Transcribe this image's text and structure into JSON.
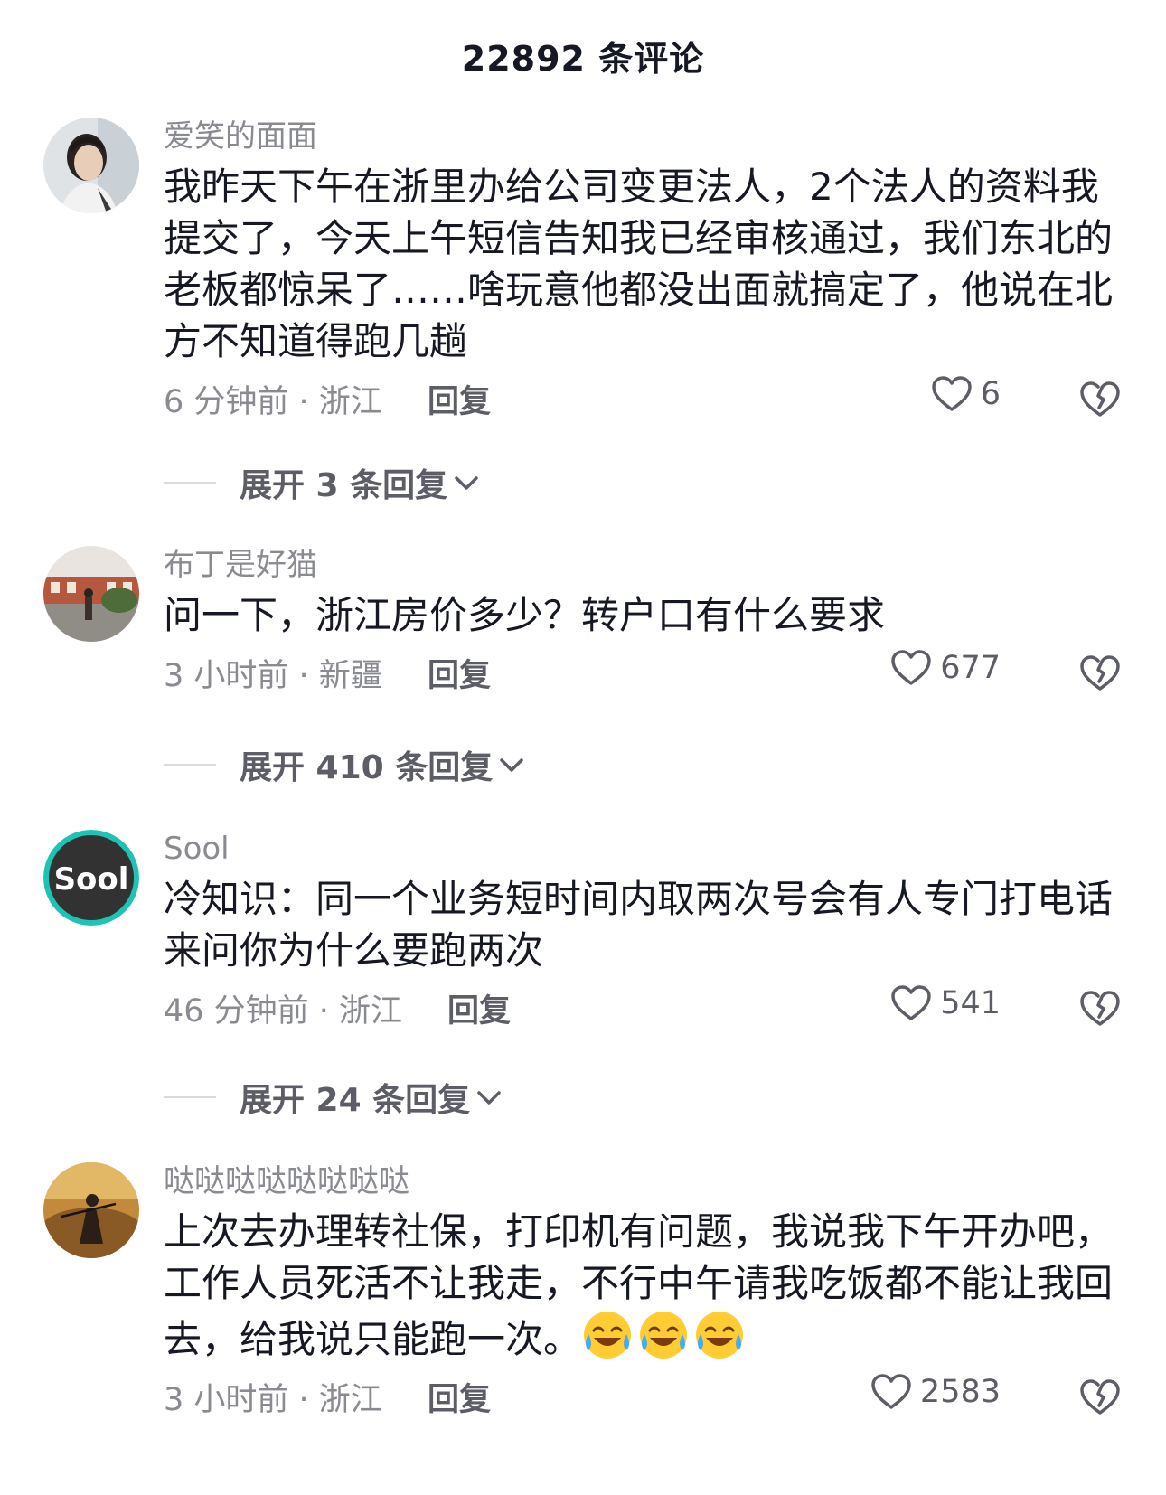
{
  "header": {
    "title": "22892 条评论"
  },
  "comments": [
    {
      "username": "爱笑的面面",
      "text": "我昨天下午在浙里办给公司变更法人，2个法人的资料我提交了，今天上午短信告知我已经审核通过，我们东北的老板都惊呆了……啥玩意他都没出面就搞定了，他说在北方不知道得跑几趟",
      "time_location": "6 分钟前 · 浙江",
      "reply_label": "回复",
      "likes": "6",
      "expand_label": "展开 3 条回复"
    },
    {
      "username": "布丁是好猫",
      "text": "问一下，浙江房价多少？转户口有什么要求",
      "time_location": "3 小时前 · 新疆",
      "reply_label": "回复",
      "likes": "677",
      "expand_label": "展开 410 条回复"
    },
    {
      "username": "Sool",
      "avatar_text": "Sool",
      "text": "冷知识：同一个业务短时间内取两次号会有人专门打电话来问你为什么要跑两次",
      "time_location": "46 分钟前 · 浙江",
      "reply_label": "回复",
      "likes": "541",
      "expand_label": "展开 24 条回复"
    },
    {
      "username": "哒哒哒哒哒哒哒哒",
      "text": "上次去办理转社保，打印机有问题，我说我下午开办吧，工作人员死活不让我走，不行中午请我吃饭都不能让我回去，给我说只能跑一次。",
      "emoji": [
        "laughing-crying-emoji",
        "laughing-crying-emoji",
        "laughing-crying-emoji"
      ],
      "time_location": "3 小时前 · 浙江",
      "reply_label": "回复",
      "likes": "2583"
    }
  ],
  "colors": {
    "primary_text": "#161823",
    "secondary_text": "#8a8b91",
    "action_text": "#5c5d66",
    "divider": "#d9dadc"
  }
}
